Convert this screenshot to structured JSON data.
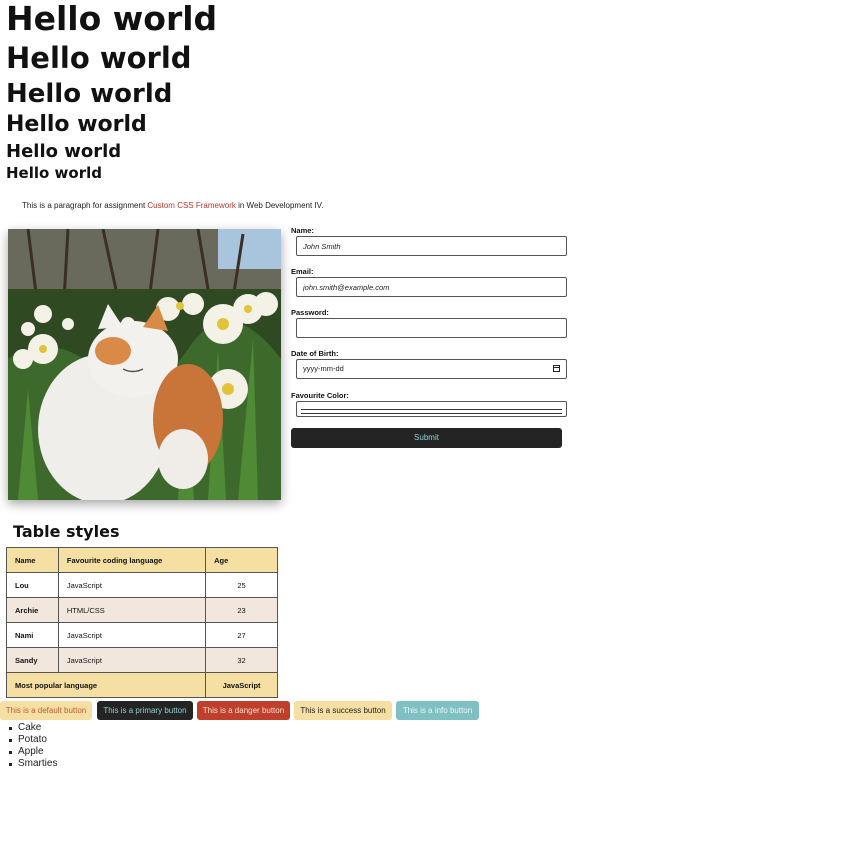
{
  "headings": {
    "h1": "Hello world",
    "h2": "Hello world",
    "h3": "Hello world",
    "h4": "Hello world",
    "h5": "Hello world",
    "h6": "Hello world"
  },
  "paragraph": {
    "before": "This is a paragraph for assignment ",
    "link": "Custom CSS Framework",
    "after": " in Web Development IV."
  },
  "form": {
    "name_label": "Name:",
    "name_value": "John Smith",
    "email_label": "Email:",
    "email_value": "john.smith@example.com",
    "password_label": "Password:",
    "password_value": "",
    "dob_label": "Date of Birth:",
    "dob_placeholder": "yyyy-mm-dd",
    "color_label": "Favourite Color:",
    "submit_label": "Submit"
  },
  "table": {
    "title": "Table styles",
    "headers": [
      "Name",
      "Favourite coding language",
      "Age"
    ],
    "rows": [
      [
        "Lou",
        "JavaScript",
        "25"
      ],
      [
        "Archie",
        "HTML/CSS",
        "23"
      ],
      [
        "Nami",
        "JavaScript",
        "27"
      ],
      [
        "Sandy",
        "JavaScript",
        "32"
      ]
    ],
    "footer_label": "Most popular language",
    "footer_value": "JavaScript"
  },
  "buttons": {
    "default": "This is a default button",
    "primary": "This is a primary button",
    "danger": "This is a danger button",
    "success": "This is a success button",
    "info": "This is a info button"
  },
  "list": [
    "Cake",
    "Potato",
    "Apple",
    "Smarties"
  ],
  "colors": {
    "link": "#b03a28",
    "table_header": "#f5dfa2",
    "table_alt_row": "#f2e7dd",
    "primary": "#242424",
    "danger": "#bf3f2c",
    "info": "#7fc0c4"
  }
}
